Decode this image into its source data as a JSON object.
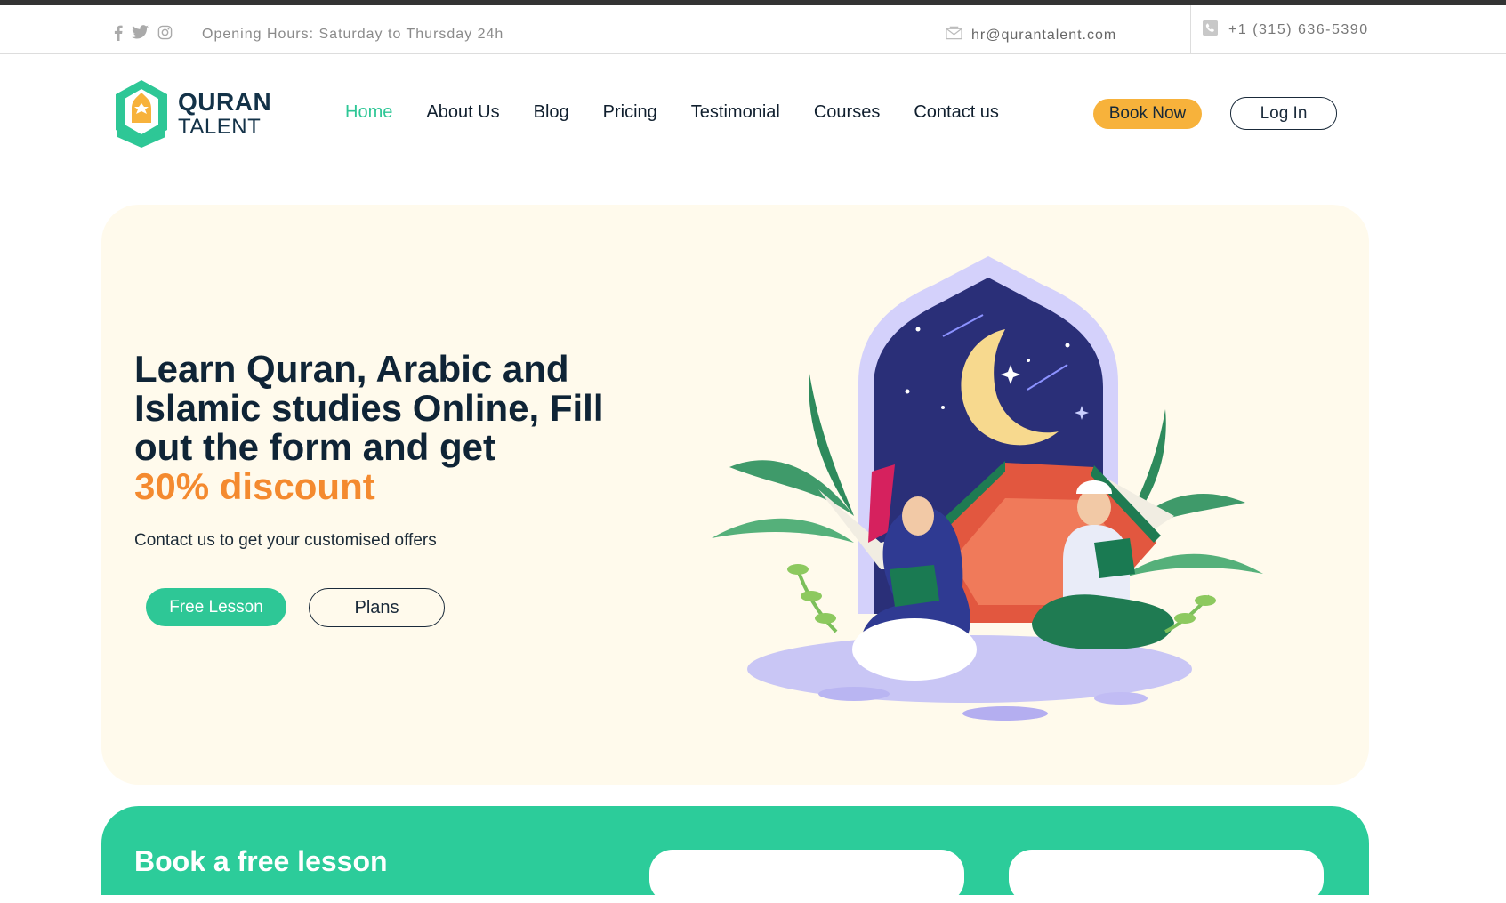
{
  "topbar": {
    "hours": "Opening Hours: Saturday to Thursday 24h",
    "email": "hr@qurantalent.com",
    "phone": "+1 (315) 636-5390",
    "social_icons": [
      "facebook-icon",
      "twitter-icon",
      "instagram-icon"
    ]
  },
  "logo": {
    "line1": "QURAN",
    "line2": "TALENT"
  },
  "nav": {
    "items": [
      "Home",
      "About Us",
      "Blog",
      "Pricing",
      "Testimonial",
      "Courses",
      "Contact us"
    ],
    "active": "Home"
  },
  "header_buttons": {
    "book": "Book Now",
    "login": "Log In"
  },
  "hero": {
    "title": "Learn Quran, Arabic and Islamic studies Online, Fill out the form and get",
    "discount": "30% discount",
    "subtitle": "Contact us to get your customised offers",
    "primary_button": "Free Lesson",
    "secondary_button": "Plans"
  },
  "booking": {
    "title": "Book a free lesson"
  },
  "colors": {
    "accent_green": "#2ec796",
    "accent_orange": "#f48a2f",
    "book_now_yellow": "#f7b23b",
    "hero_bg": "#fffaec",
    "text_dark": "#0f2436"
  }
}
